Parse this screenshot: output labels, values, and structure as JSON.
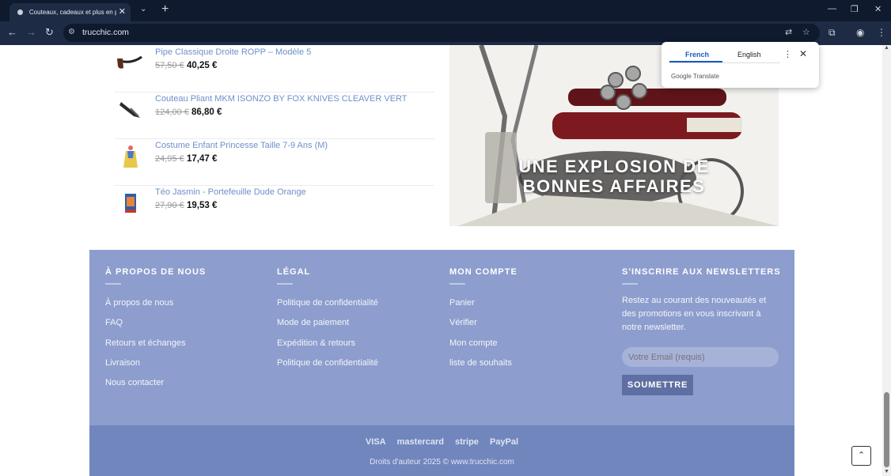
{
  "browser": {
    "tab_title": "Couteaux, cadeaux et plus en p",
    "url": "trucchic.com"
  },
  "translate_popup": {
    "source_lang": "French",
    "target_lang": "English",
    "brand": "Google Translate"
  },
  "products": [
    {
      "name": "Pipe Classique Droite ROPP – Modèle 5",
      "old_price": "57,50 €",
      "price": "40,25 €",
      "icon": "pipe-icon"
    },
    {
      "name": "Couteau Pliant MKM ISONZO BY FOX KNIVES CLEAVER VERT",
      "old_price": "124,00 €",
      "price": "86,80 €",
      "icon": "knife-icon"
    },
    {
      "name": "Costume Enfant Princesse Taille 7-9 Ans (M)",
      "old_price": "24,95 €",
      "price": "17,47 €",
      "icon": "costume-icon"
    },
    {
      "name": "Téo Jasmin - Portefeuille Dude Orange",
      "old_price": "27,90 €",
      "price": "19,53 €",
      "icon": "wallet-icon"
    }
  ],
  "promo": {
    "line1": "UNE EXPLOSION DE",
    "line2": "BONNES AFFAIRES"
  },
  "footer": {
    "about": {
      "title": "À PROPOS DE NOUS",
      "links": [
        "À propos de nous",
        "FAQ",
        "Retours et échanges",
        "Livraison",
        "Nous contacter"
      ]
    },
    "legal": {
      "title": "LÉGAL",
      "links": [
        "Politique de confidentialité",
        "Mode de paiement",
        "Expédition & retours",
        "Politique de confidentialité"
      ]
    },
    "account": {
      "title": "MON COMPTE",
      "links": [
        "Panier",
        "Vérifier",
        "Mon compte",
        "liste de souhaits"
      ]
    },
    "newsletter": {
      "title": "S'INSCRIRE AUX NEWSLETTERS",
      "text": "Restez au courant des nouveautés et des promotions en vous inscrivant à notre newsletter.",
      "placeholder": "Votre Email (requis)",
      "button": "SOUMETTRE"
    }
  },
  "payments": [
    "VISA",
    "mastercard",
    "stripe",
    "PayPal"
  ],
  "copyright": "Droits d'auteur 2025 © www.trucchic.com"
}
